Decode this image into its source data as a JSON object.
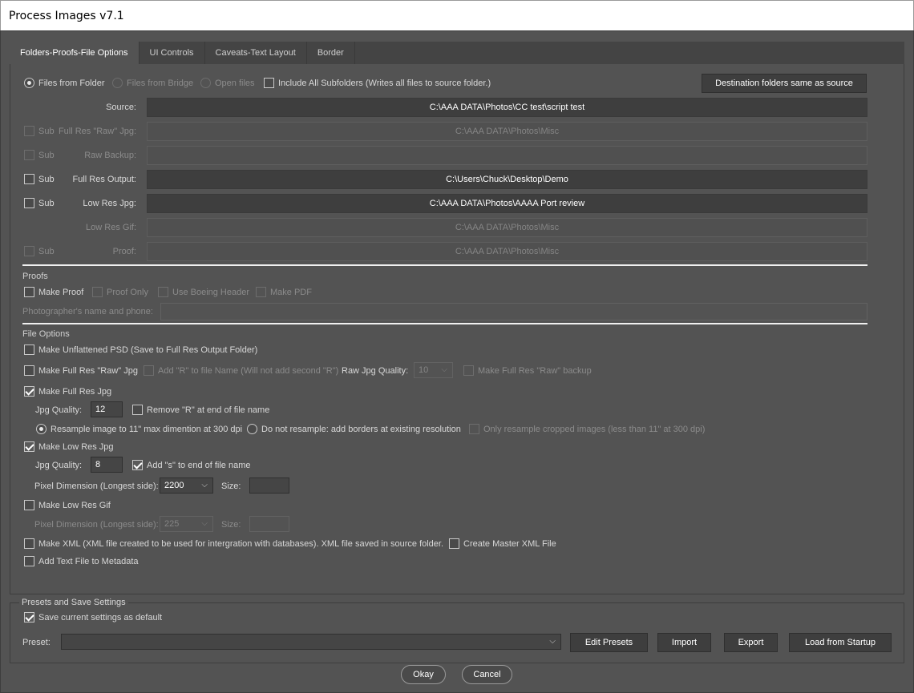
{
  "window": {
    "title": "Process Images v7.1"
  },
  "tabs": [
    "Folders-Proofs-File Options",
    "UI Controls",
    "Caveats-Text Layout",
    "Border"
  ],
  "source_mode": {
    "files_from_folder": "Files from Folder",
    "files_from_bridge": "Files from Bridge",
    "open_files": "Open files",
    "include_subfolders": "Include All Subfolders (Writes all files to source folder.)",
    "dest_button": "Destination folders same as source"
  },
  "folders": {
    "sub_label": "Sub",
    "source_label": "Source:",
    "source_path": "C:\\AAA DATA\\Photos\\CC test\\script test",
    "full_res_raw_label": "Full Res \"Raw\" Jpg:",
    "full_res_raw_path": "C:\\AAA DATA\\Photos\\Misc",
    "raw_backup_label": "Raw Backup:",
    "raw_backup_path": "",
    "full_res_output_label": "Full Res Output:",
    "full_res_output_path": "C:\\Users\\Chuck\\Desktop\\Demo",
    "low_res_jpg_label": "Low Res Jpg:",
    "low_res_jpg_path": "C:\\AAA DATA\\Photos\\AAAA Port review",
    "low_res_gif_label": "Low Res Gif:",
    "low_res_gif_path": "C:\\AAA DATA\\Photos\\Misc",
    "proof_label": "Proof:",
    "proof_path": "C:\\AAA DATA\\Photos\\Misc"
  },
  "proofs": {
    "title": "Proofs",
    "make_proof": "Make Proof",
    "proof_only": "Proof Only",
    "boeing_header": "Use Boeing Header",
    "make_pdf": "Make PDF",
    "photographer_label": "Photographer's name and phone:",
    "photographer_value": ""
  },
  "file_options": {
    "title": "File Options",
    "unflattened_psd": "Make Unflattened PSD (Save to Full Res Output Folder)",
    "full_res_raw_jpg": "Make Full Res \"Raw\" Jpg",
    "add_r": "Add \"R\" to file Name (Will not add second \"R\")",
    "raw_quality_label": "Raw Jpg Quality:",
    "raw_quality_value": "10",
    "raw_backup": "Make Full Res \"Raw\" backup",
    "full_res_jpg": "Make Full Res Jpg",
    "jpg_quality_label": "Jpg Quality:",
    "full_jpg_quality": "12",
    "remove_r": "Remove \"R\" at end of file name",
    "resample": "Resample image to 11\" max dimention at 300 dpi",
    "no_resample": "Do not resample: add borders at existing resolution",
    "only_resample": "Only resample cropped images (less than 11\" at 300 dpi)",
    "low_res_jpg": "Make Low Res Jpg",
    "low_jpg_quality": "8",
    "add_s": "Add \"s\" to end of file name",
    "pixel_dim_label": "Pixel Dimension (Longest side):",
    "pixel_dim_jpg": "2200",
    "size_label": "Size:",
    "size_value": "",
    "low_res_gif": "Make Low Res Gif",
    "pixel_dim_gif": "225",
    "gif_size_value": "",
    "make_xml": "Make XML (XML file created to be used for intergration with databases).  XML file saved in source folder.",
    "master_xml": "Create Master XML File",
    "add_text_file": "Add Text File to Metadata"
  },
  "presets": {
    "title": "Presets and Save Settings",
    "save_default": "Save current settings as default",
    "preset_label": "Preset:",
    "preset_value": "",
    "edit": "Edit Presets",
    "import": "Import",
    "export": "Export",
    "load_startup": "Load from Startup"
  },
  "footer": {
    "okay": "Okay",
    "cancel": "Cancel"
  },
  "icons": {
    "dropdown": "chevron-down-icon",
    "check": "checkmark-icon"
  },
  "colors": {
    "background": "#535353",
    "field": "#3e3e3e",
    "text": "#d8d8d8"
  }
}
